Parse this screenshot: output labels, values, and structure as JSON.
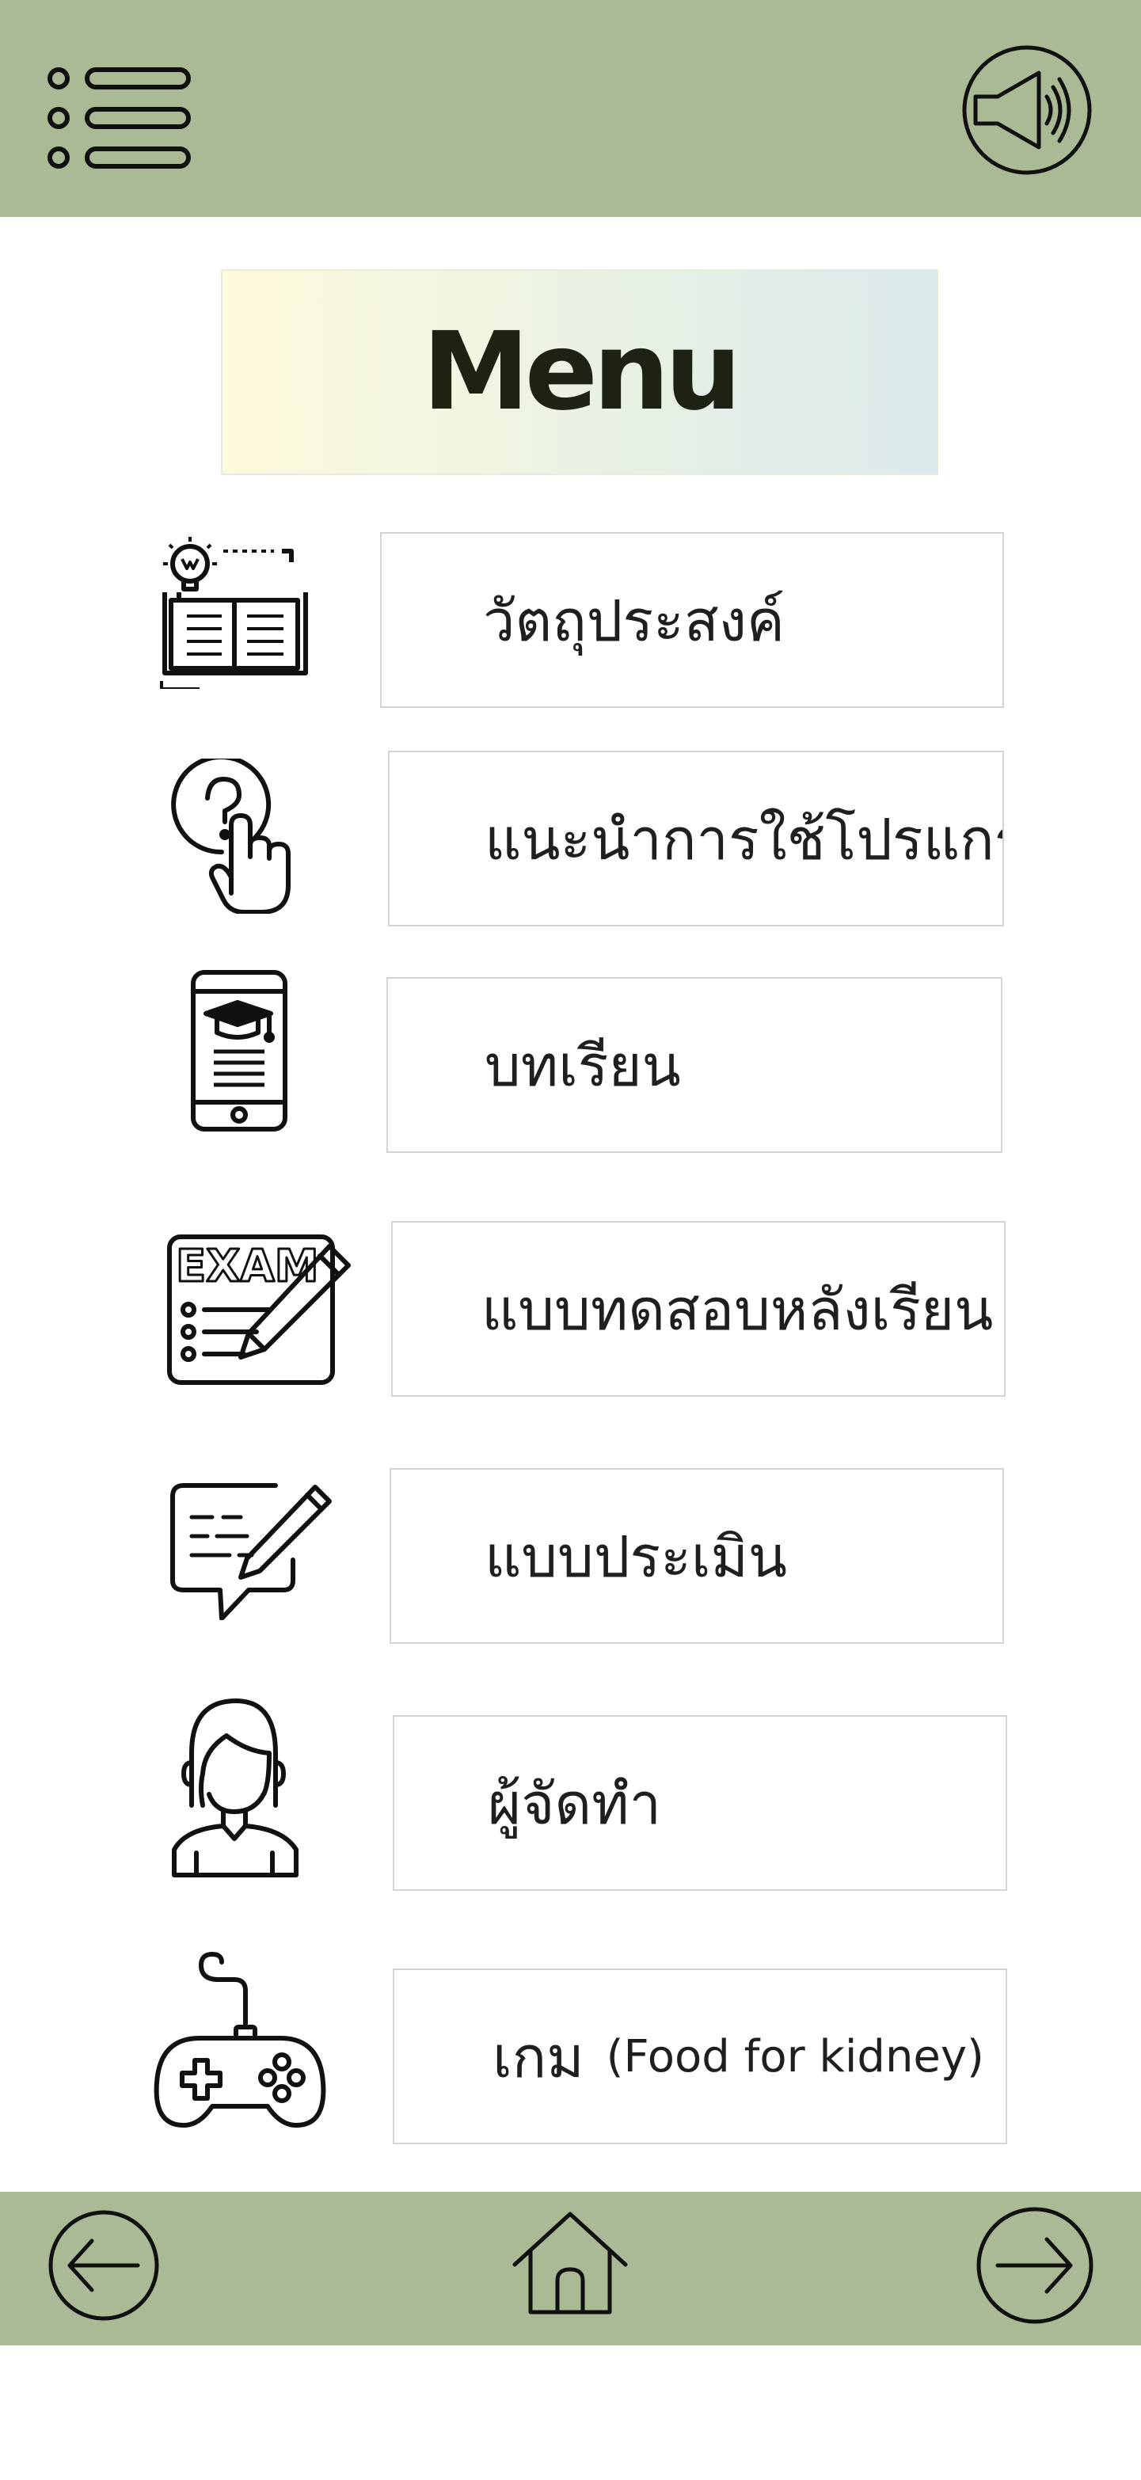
{
  "header": {
    "menu_icon": "hamburger-list-icon",
    "sound_icon": "speaker-icon"
  },
  "title": "Menu",
  "menu": [
    {
      "label": "วัตถุประสงค์",
      "icon": "objectives-book-icon"
    },
    {
      "label": "แนะนำการใช้โปรแกรม",
      "icon": "help-question-hand-icon"
    },
    {
      "label": "บทเรียน",
      "icon": "mobile-lesson-icon"
    },
    {
      "label": "แบบทดสอบหลังเรียน",
      "icon": "exam-icon"
    },
    {
      "label": "แบบประเมิน",
      "icon": "feedback-pencil-icon"
    },
    {
      "label": "ผู้จัดทำ",
      "icon": "creator-person-icon"
    },
    {
      "label": "เกม",
      "sub": "(Food for kidney)",
      "icon": "game-controller-icon"
    }
  ],
  "footer": {
    "back_icon": "arrow-left-circle-icon",
    "home_icon": "home-icon",
    "next_icon": "arrow-right-circle-icon"
  },
  "colors": {
    "bar": "#a9ba95",
    "title_text": "#1d2213",
    "box_border": "#d4d4d4"
  }
}
